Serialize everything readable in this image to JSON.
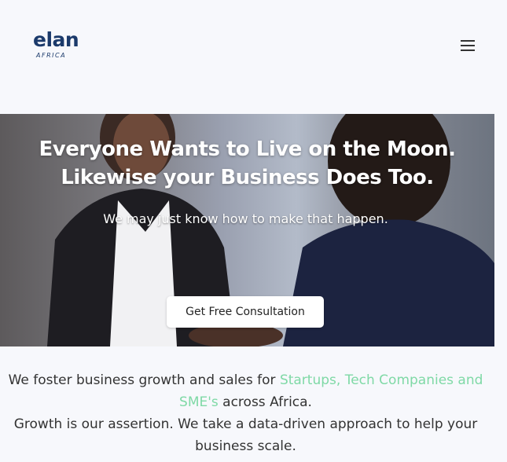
{
  "header": {
    "logo_word": "elan",
    "logo_sub": "AFRICA",
    "menu_icon": "hamburger-menu-icon"
  },
  "hero": {
    "title_line1": "Everyone Wants to Live on the Moon.",
    "title_line2": "Likewise your Business Does Too.",
    "subtitle": "We may just know how to make that happen.",
    "cta_label": "Get Free Consultation"
  },
  "intro": {
    "line1_before": "We foster business growth and sales for ",
    "highlight": "Startups, Tech Companies and SME's",
    "line1_after": " across Africa.",
    "line2": "Growth is our assertion. We take a data-driven approach to help your business scale."
  },
  "colors": {
    "brand": "#1b3a6b",
    "highlight": "#7fd9a6",
    "background": "#f7f8fc"
  }
}
